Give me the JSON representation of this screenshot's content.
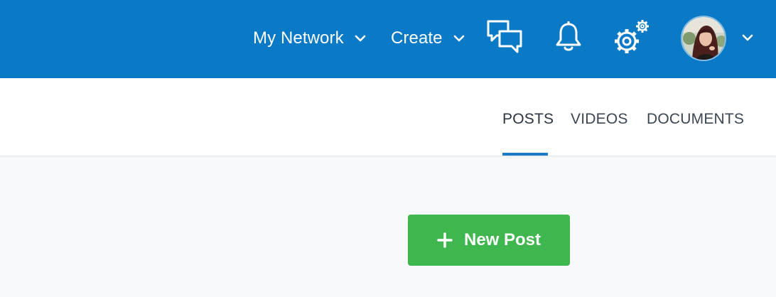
{
  "header": {
    "menus": [
      {
        "label": "My Network"
      },
      {
        "label": "Create"
      }
    ],
    "icons": {
      "chat": "chat-bubbles-icon",
      "notifications": "bell-icon",
      "settings": "gears-icon",
      "account_menu": "chevron-down-icon"
    },
    "background_color": "#0a79c6"
  },
  "tabs": [
    {
      "label": "POSTS",
      "active": true
    },
    {
      "label": "VIDEOS",
      "active": false
    },
    {
      "label": "DOCUMENTS",
      "active": false
    }
  ],
  "actions": {
    "new_post_label": "New Post",
    "new_post_icon": "plus-icon",
    "new_post_color": "#3fb64e"
  }
}
